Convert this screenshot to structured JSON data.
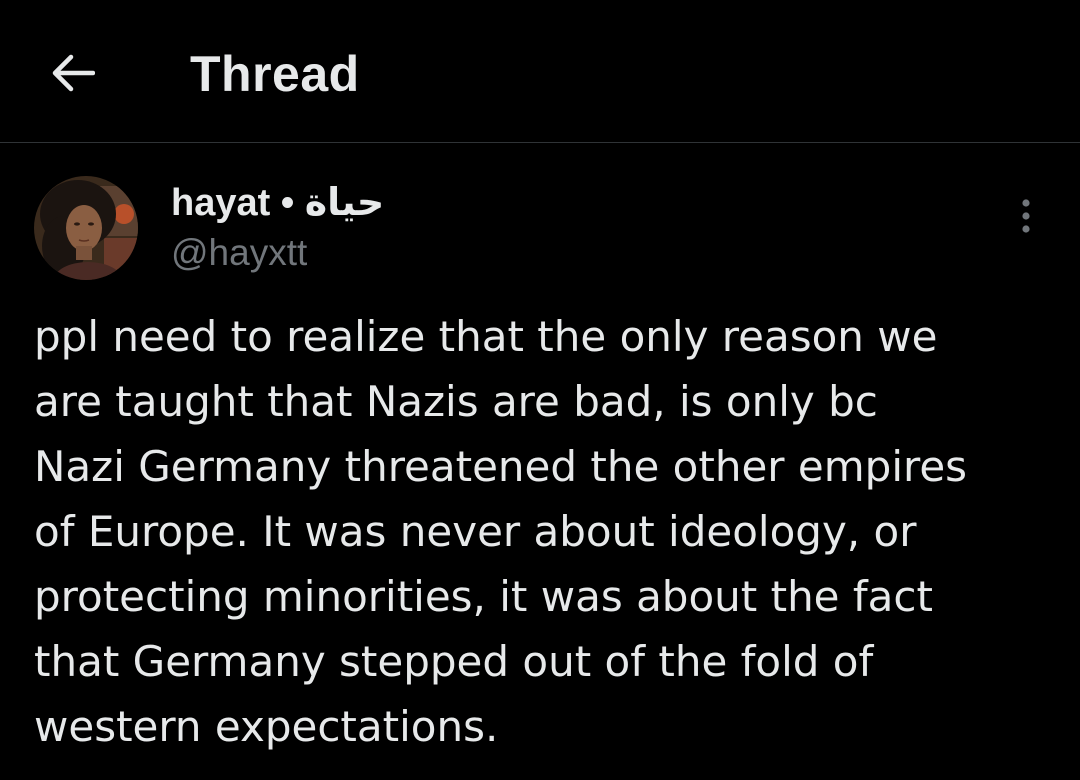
{
  "header": {
    "title": "Thread",
    "back_icon": "arrow-left-icon"
  },
  "tweet": {
    "author": {
      "display_name": "hayat • حياة",
      "handle": "@hayxtt",
      "avatar_icon": "profile-photo"
    },
    "more_icon": "more-vertical-icon",
    "text_lines": [
      "ppl need to realize that the only reason we",
      "are taught that Nazis are bad, is only bc",
      "Nazi Germany threatened the other empires",
      "of Europe. It was never about ideology, or",
      "protecting minorities, it was about the fact",
      "that Germany stepped out of the fold of",
      "western expectations."
    ]
  },
  "colors": {
    "background": "#000000",
    "primary_text": "#e7e9ea",
    "secondary_text": "#71767b",
    "divider": "#2f3336"
  }
}
